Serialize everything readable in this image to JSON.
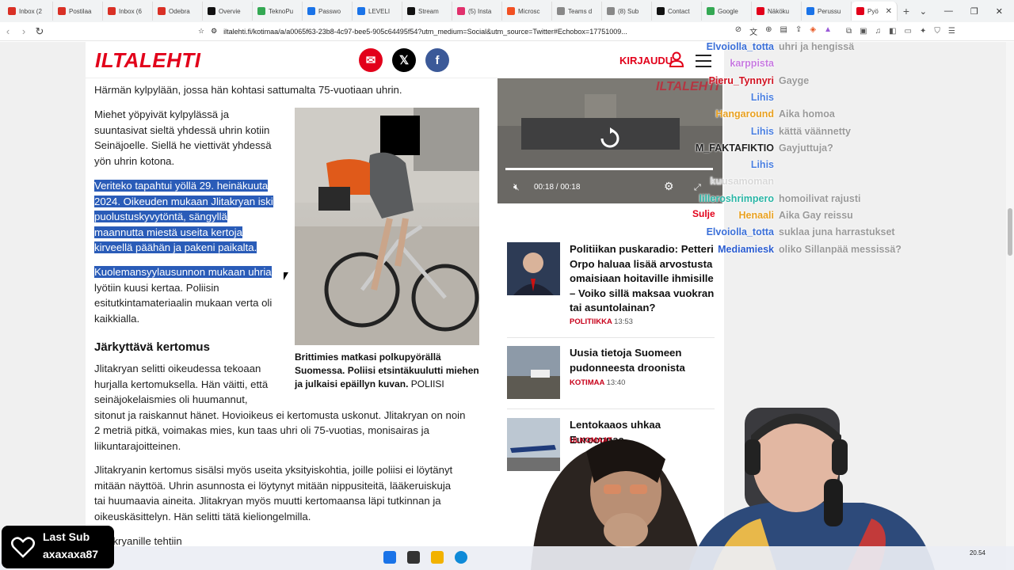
{
  "tabs": [
    {
      "label": "Inbox (2",
      "fav": "#d93025"
    },
    {
      "label": "Postilaa",
      "fav": "#d93025"
    },
    {
      "label": "Inbox (6",
      "fav": "#d93025"
    },
    {
      "label": "Odebra",
      "fav": "#d93025"
    },
    {
      "label": "Overvie",
      "fav": "#111111"
    },
    {
      "label": "TeknoPu",
      "fav": "#34a853"
    },
    {
      "label": "Passwo",
      "fav": "#1a73e8"
    },
    {
      "label": "LEVELI",
      "fav": "#1a73e8"
    },
    {
      "label": "Stream",
      "fav": "#111111"
    },
    {
      "label": "(5) Insta",
      "fav": "#e1306c"
    },
    {
      "label": "Microsc",
      "fav": "#f25022"
    },
    {
      "label": "Teams d",
      "fav": "#888888"
    },
    {
      "label": "(8) Sub",
      "fav": "#888888"
    },
    {
      "label": "Contact",
      "fav": "#111111"
    },
    {
      "label": "Google",
      "fav": "#34a853"
    },
    {
      "label": "Näköku",
      "fav": "#e2001a"
    },
    {
      "label": "Perussu",
      "fav": "#1a73e8"
    },
    {
      "label": "Pyö",
      "fav": "#e2001a"
    }
  ],
  "address": {
    "url": "iltalehti.fi/kotimaa/a/a0065f63-23b8-4c97-bee5-905c64495f54?utm_medium=Social&utm_source=Twitter#Echobox=17751009..."
  },
  "site": {
    "logo": "ILTALEHTI",
    "login": "KIRJAUDU",
    "mail": "✉",
    "x": "𝕏",
    "fb": "f"
  },
  "article": {
    "p0": "Härmän kylpylään, jossa hän kohtasi sattumalta 75-vuotiaan uhrin.",
    "p1": [
      "Miehet yöpyivät kylpylässä ja",
      "suuntasivat sieltä yhdessä uhrin kotiin",
      "Seinäjoelle. Siellä he viettivät yhdessä",
      "yön uhrin kotona."
    ],
    "p2": [
      "Veriteko tapahtui yöllä 29. heinäkuuta",
      "2024. Oikeuden mukaan Jlitakryan iski",
      "puolustuskyvytöntä, sängyllä",
      "maannutta miestä useita kertoja",
      "kirveellä päähän ja pakeni paikalta."
    ],
    "p3a": "Kuolemansyylausunnon mukaan uhria",
    "p3": [
      "lyötiin kuusi kertaa. Poliisin",
      "esitutkintamateriaalin mukaan verta oli",
      "kaikkialla."
    ],
    "heading": "Järkyttävä kertomus",
    "p4": [
      "Jlitakryan selitti oikeudessa tekoaan",
      "hurjalla kertomuksella. Hän väitti, että",
      "seinäjokelaismies oli huumannut,",
      "sitonut ja raiskannut hänet. Hovioikeus ei kertomusta uskonut. Jlitakryan on noin",
      "2 metriä pitkä, voimakas mies, kun taas uhri oli 75-vuotias, monisairas ja",
      "liikuntarajoitteinen."
    ],
    "p5": [
      "Jlitakryanin kertomus sisälsi myös useita yksityiskohtia, joille poliisi ei löytänyt",
      "mitään näyttöä. Uhrin asunnosta ei löytynyt mitään nippusiteitä, lääkeruiskuja",
      "tai huumaavia aineita. Jlitakryan myös muutti kertomaansa läpi tutkinnan ja",
      "oikeuskäsittelyn. Hän selitti tätä kieliongelmilla."
    ],
    "p6": "Jlitakryanille tehtiin",
    "caption": "Brittimies matkasi polkupyörällä Suomessa. Poliisi etsintäkuulutti miehen ja julkaisi epäillyn kuvan.",
    "caption_src": "POLIISI"
  },
  "video": {
    "time": "00:18  /  00:18",
    "logo": "ILTALEHTI",
    "close": "Sulje"
  },
  "news": [
    {
      "title": "Politiikan puskaradio: Petteri Orpo haluaa lisää arvostusta omaisiaan hoitaville ihmisille – Voiko sillä maksaa vuokran tai asuntolainan?",
      "section": "POLITIIKKA",
      "time": "13:53"
    },
    {
      "title": "Uusia tietoja Suomeen pudonneesta droonista",
      "section": "KOTIMAA",
      "time": "13:40"
    },
    {
      "title": "Lentokaaos uhkaa Eurooppaa",
      "section": "ULKOMAAT",
      "time": ""
    }
  ],
  "chat": [
    {
      "name": "Elvoiolla_totta",
      "color": "#3a6fd8",
      "msg": "uhri ja hengissä"
    },
    {
      "name": "karppista",
      "color": "#c77be0",
      "msg": ""
    },
    {
      "name": "Pieru_Tynnyri",
      "color": "#d01020",
      "msg": "Gayge"
    },
    {
      "name": "Lihis",
      "color": "#4a7fe0",
      "msg": ""
    },
    {
      "name": "Hangaround",
      "color": "#e8a020",
      "msg": "Aika homoa"
    },
    {
      "name": "Lihis",
      "color": "#4a7fe0",
      "msg": "kättä väännetty"
    },
    {
      "name": "M_FAKTAFIKTIO",
      "color": "#222222",
      "msg": "Gayjuttuja?"
    },
    {
      "name": "Lihis",
      "color": "#4a7fe0",
      "msg": ""
    },
    {
      "name": "kuusamoman",
      "color": "#d8d8d8",
      "msg": ""
    },
    {
      "name": "lilleroshrimpero",
      "color": "#2ab5a5",
      "msg": "homoilivat rajusti"
    },
    {
      "name": "Henaali",
      "color": "#e8a020",
      "msg": "Aika Gay reissu"
    },
    {
      "name": "Elvoiolla_totta",
      "color": "#3a6fd8",
      "msg": "suklaa juna harrastukset"
    },
    {
      "name": "Mediamiesk",
      "color": "#2a5cd0",
      "msg": "oliko Sillanpää messissä?"
    }
  ],
  "overlay": {
    "last_sub_label": "Last Sub",
    "last_sub_user": "axaxaxa87"
  },
  "clock": {
    "time": "20.54"
  }
}
